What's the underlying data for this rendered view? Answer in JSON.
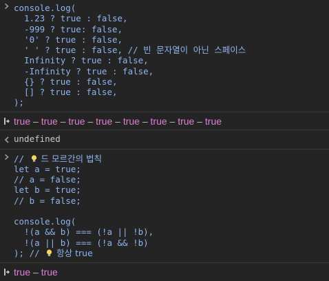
{
  "entry1": {
    "prompt_icon": "chevron-right-icon",
    "lines": [
      "console.log(",
      "  1.23 ? true : false,",
      "  -999 ? true: false,",
      "  '0' ? true : false,",
      "  ' ' ? true : false, // 빈 문자열이 아닌 스페이스",
      "  Infinity ? true : false,",
      "  -Infinity ? true : false,",
      "  {} ? true : false,",
      "  [] ? true : false,",
      ");"
    ]
  },
  "result1": {
    "icon": "result-return-icon",
    "values": [
      "true",
      "true",
      "true",
      "true",
      "true",
      "true",
      "true",
      "true"
    ],
    "separator": "–"
  },
  "undefined_entry": {
    "icon": "back-arrow-icon",
    "text": "undefined"
  },
  "entry2": {
    "prompt_icon": "chevron-right-icon",
    "comment_prefix": "// ",
    "comment_text": " 드 모르간의 법칙",
    "lines": [
      "let a = true;",
      "// a = false;",
      "let b = true;",
      "// b = false;",
      "",
      "console.log(",
      "  !(a && b) === (!a || !b),",
      "  !(a || b) === (!a && !b)"
    ],
    "last_prefix": "); // ",
    "last_text": " 항상 true"
  },
  "result2": {
    "icon": "result-return-icon",
    "values": [
      "true",
      "true"
    ],
    "separator": "–"
  },
  "colors": {
    "background": "#242424",
    "code": "#8fb4ef",
    "result": "#e07fd8",
    "undefined": "#c8c8c8",
    "divider": "#3a3a3a"
  }
}
